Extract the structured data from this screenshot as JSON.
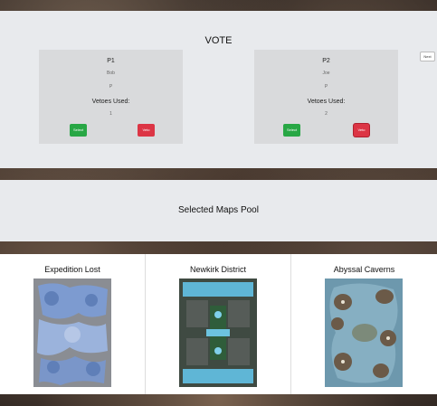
{
  "vote_panel": {
    "title": "VOTE",
    "next_label": "Next",
    "players": [
      {
        "name": "P1",
        "user": "Bob",
        "race": "P",
        "vetoes_label": "Vetoes Used:",
        "vetoes_used": "1",
        "select_label": "Select",
        "veto_label": "Veto"
      },
      {
        "name": "P2",
        "user": "Joe",
        "race": "P",
        "vetoes_label": "Vetoes Used:",
        "vetoes_used": "2",
        "select_label": "Select",
        "veto_label": "Veto"
      }
    ]
  },
  "pool": {
    "title": "Selected Maps Pool",
    "maps": [
      {
        "name": "Expedition Lost"
      },
      {
        "name": "Newkirk District"
      },
      {
        "name": "Abyssal Caverns"
      }
    ]
  },
  "colors": {
    "select_green": "#28a745",
    "veto_red": "#dc3545",
    "panel_bg": "#e8eaed",
    "card_bg": "#d9dadc"
  }
}
